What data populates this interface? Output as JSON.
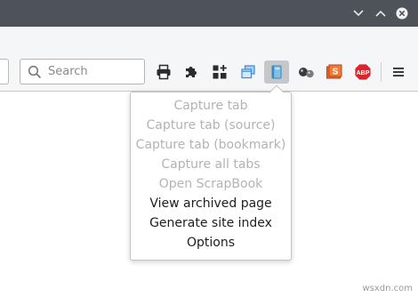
{
  "search": {
    "placeholder": "Search"
  },
  "toolbar": {
    "buttons": [
      {
        "icon": "print-icon"
      },
      {
        "icon": "puzzle-icon"
      },
      {
        "icon": "dashboard-add-icon"
      },
      {
        "icon": "windows-stack-icon"
      },
      {
        "icon": "scrapbook-icon",
        "active": true
      },
      {
        "icon": "molecules-icon"
      },
      {
        "icon": "slideshow-s-icon"
      },
      {
        "icon": "adblock-plus-icon",
        "text": "ABP"
      },
      {
        "icon": "hamburger-menu-icon"
      }
    ]
  },
  "menu": {
    "items": [
      {
        "label": "Capture tab",
        "enabled": false
      },
      {
        "label": "Capture tab (source)",
        "enabled": false
      },
      {
        "label": "Capture tab (bookmark)",
        "enabled": false
      },
      {
        "label": "Capture all tabs",
        "enabled": false
      },
      {
        "label": "Open ScrapBook",
        "enabled": false
      },
      {
        "label": "View archived page",
        "enabled": true
      },
      {
        "label": "Generate site index",
        "enabled": true
      },
      {
        "label": "Options",
        "enabled": true
      }
    ]
  },
  "watermark": "wsxdn.com",
  "colors": {
    "titlebar": "#4d5358",
    "toolbar": "#f5f6f7",
    "menu_text": "#1e1e1e",
    "menu_text_disabled": "#b3b3b3",
    "abp_red": "#d9262c",
    "slideshow_orange": "#e9662c",
    "windows_blue": "#3b8bd6"
  }
}
